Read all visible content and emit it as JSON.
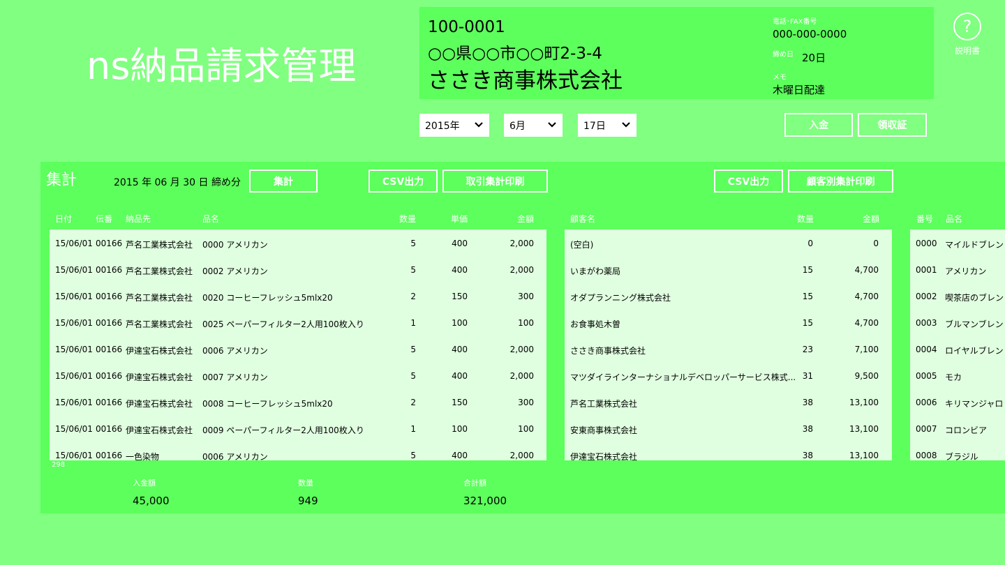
{
  "app_title": "ns納品請求管理",
  "customer": {
    "zip": "100-0001",
    "address": "○○県○○市○○町2-3-4",
    "name": "ささき商事株式会社",
    "phone_label": "電話･FAX番号",
    "phone": "000-000-0000",
    "close_label": "締め日",
    "close_day": "20日",
    "memo_label": "メモ",
    "memo": "木曜日配達"
  },
  "help": {
    "label": "説明書"
  },
  "date_selector": {
    "year": "2015年",
    "month": "6月",
    "day": "17日"
  },
  "actions": {
    "payment": "入金",
    "receipt": "領収証"
  },
  "summary": {
    "title": "集計",
    "cutoff": "2015 年 06 月 30 日 締め分",
    "aggregate_button": "集計",
    "csv_button_1": "CSV出力",
    "transaction_print_button": "取引集計印刷",
    "csv_button_2": "CSV出力",
    "customer_print_button": "顧客別集計印刷"
  },
  "transactions": {
    "headers": [
      "日付",
      "伝番",
      "納品先",
      "品名",
      "数量",
      "単価",
      "金額"
    ],
    "rows": [
      [
        "15/06/01",
        "00166",
        "芦名工業株式会社",
        "0000 アメリカン",
        "5",
        "400",
        "2,000"
      ],
      [
        "15/06/01",
        "00166",
        "芦名工業株式会社",
        "0002 アメリカン",
        "5",
        "400",
        "2,000"
      ],
      [
        "15/06/01",
        "00166",
        "芦名工業株式会社",
        "0020 コーヒーフレッシュ5mlx20",
        "2",
        "150",
        "300"
      ],
      [
        "15/06/01",
        "00166",
        "芦名工業株式会社",
        "0025 ペーパーフィルター2人用100枚入り",
        "1",
        "100",
        "100"
      ],
      [
        "15/06/01",
        "00166",
        "伊達宝石株式会社",
        "0006 アメリカン",
        "5",
        "400",
        "2,000"
      ],
      [
        "15/06/01",
        "00166",
        "伊達宝石株式会社",
        "0007 アメリカン",
        "5",
        "400",
        "2,000"
      ],
      [
        "15/06/01",
        "00166",
        "伊達宝石株式会社",
        "0008 コーヒーフレッシュ5mlx20",
        "2",
        "150",
        "300"
      ],
      [
        "15/06/01",
        "00166",
        "伊達宝石株式会社",
        "0009 ペーパーフィルター2人用100枚入り",
        "1",
        "100",
        "100"
      ],
      [
        "15/06/01",
        "00166",
        "一色染物",
        "0006 アメリカン",
        "5",
        "400",
        "2,000"
      ]
    ],
    "row_count": "298"
  },
  "customers": {
    "headers": [
      "顧客名",
      "数量",
      "金額"
    ],
    "rows": [
      [
        "(空白)",
        "0",
        "0"
      ],
      [
        "いまがわ薬局",
        "15",
        "4,700"
      ],
      [
        "オダプランニング株式会社",
        "15",
        "4,700"
      ],
      [
        "お食事処木曽",
        "15",
        "4,700"
      ],
      [
        "ささき商事株式会社",
        "23",
        "7,100"
      ],
      [
        "マツダイラインターナショナルデベロッパーサービス株式...",
        "31",
        "9,500"
      ],
      [
        "芦名工業株式会社",
        "38",
        "13,100"
      ],
      [
        "安東商事株式会社",
        "38",
        "13,100"
      ],
      [
        "伊達宝石株式会社",
        "38",
        "13,100"
      ]
    ]
  },
  "products": {
    "headers": [
      "番号",
      "品名"
    ],
    "rows": [
      [
        "0000",
        "マイルドブレンド"
      ],
      [
        "0001",
        "アメリカン"
      ],
      [
        "0002",
        "喫茶店のブレンド"
      ],
      [
        "0003",
        "ブルマンブレンド"
      ],
      [
        "0004",
        "ロイヤルブレンド"
      ],
      [
        "0005",
        "モカ"
      ],
      [
        "0006",
        "キリマンジャロ"
      ],
      [
        "0007",
        "コロンビア"
      ],
      [
        "0008",
        "ブラジル"
      ]
    ]
  },
  "totals": {
    "payment_label": "入金額",
    "payment": "45,000",
    "quantity_label": "数量",
    "quantity": "949",
    "total_label": "合計額",
    "total": "321,000"
  }
}
